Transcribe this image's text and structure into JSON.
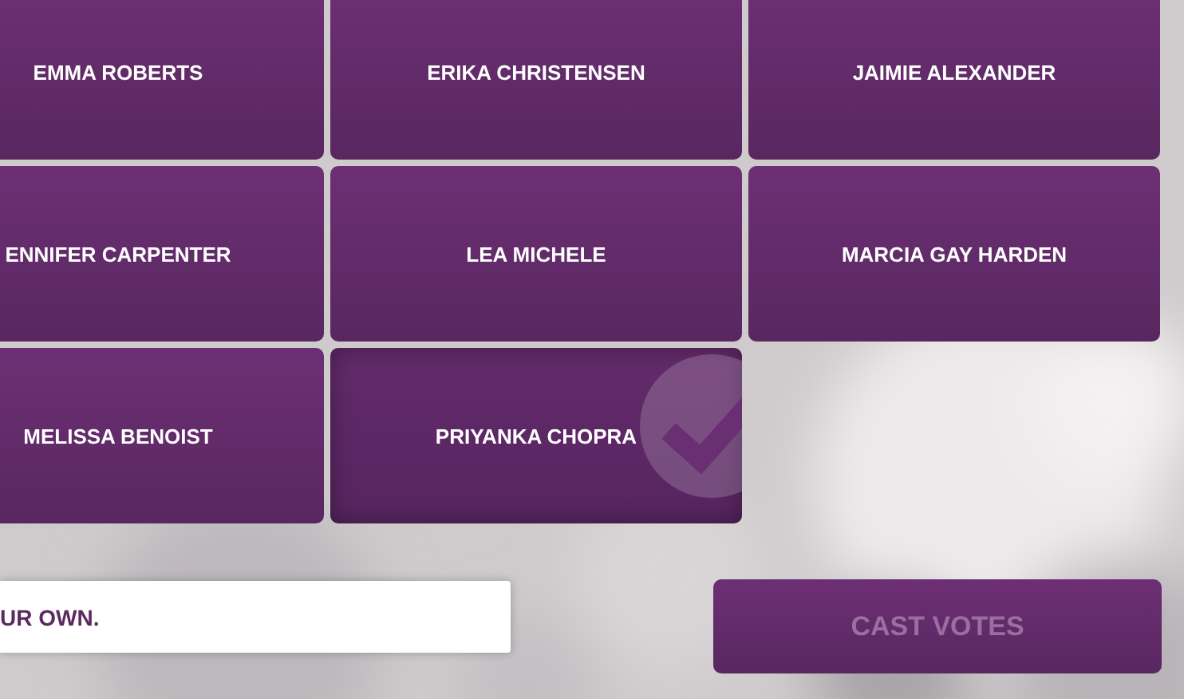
{
  "candidates": [
    {
      "name": "EMMA ROBERTS",
      "selected": false
    },
    {
      "name": "ERIKA CHRISTENSEN",
      "selected": false
    },
    {
      "name": "JAIMIE ALEXANDER",
      "selected": false
    },
    {
      "name": "ENNIFER CARPENTER",
      "selected": false
    },
    {
      "name": "LEA MICHELE",
      "selected": false
    },
    {
      "name": "MARCIA GAY HARDEN",
      "selected": false
    },
    {
      "name": "MELISSA BENOIST",
      "selected": false
    },
    {
      "name": "PRIYANKA CHOPRA",
      "selected": true
    }
  ],
  "write_in": {
    "placeholder": "UR OWN."
  },
  "cast_button": {
    "label": "CAST VOTES",
    "disabled": true
  }
}
